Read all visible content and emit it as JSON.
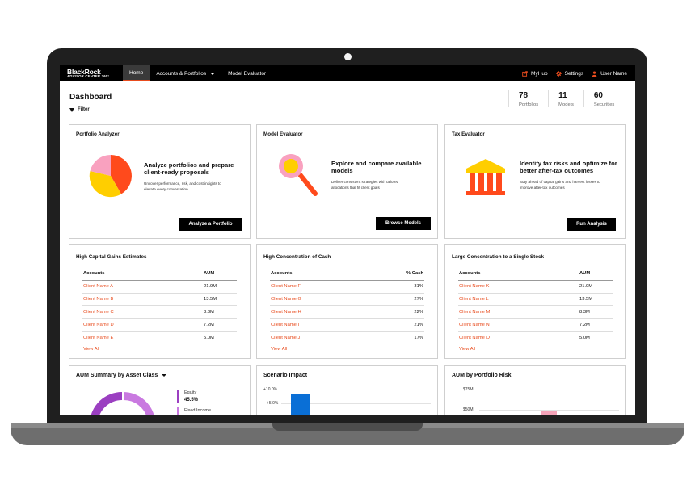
{
  "nav": {
    "logo_line1": "BlackRock",
    "logo_line2": "ADVISOR CENTER 360°",
    "items": [
      {
        "label": "Home",
        "active": true
      },
      {
        "label": "Accounts & Portfolios",
        "dropdown": true
      },
      {
        "label": "Model Evaluator"
      }
    ],
    "right": [
      {
        "label": "MyHub",
        "icon": "external-link-icon"
      },
      {
        "label": "Settings",
        "icon": "gear-icon"
      },
      {
        "label": "User Name",
        "icon": "user-icon"
      }
    ]
  },
  "page": {
    "title": "Dashboard",
    "filter_label": "Filter"
  },
  "stats": [
    {
      "value": "78",
      "label": "Portfolios"
    },
    {
      "value": "11",
      "label": "Models"
    },
    {
      "value": "60",
      "label": "Securities"
    }
  ],
  "tools": [
    {
      "title": "Portfolio Analyzer",
      "heading": "Analyze portfolios and prepare client-ready proposals",
      "desc": "Uncover performance, risk, and cost insights to elevate every conversation",
      "button": "Analyze a Portfolio",
      "icon": "pie-chart-icon"
    },
    {
      "title": "Model Evaluator",
      "heading": "Explore and compare available models",
      "desc": "Deliver consistent strategies with tailored allocations that fit client goals",
      "button": "Browse Models",
      "icon": "magnifier-icon"
    },
    {
      "title": "Tax Evaluator",
      "heading": "Identify tax risks and optimize for better after-tax outcomes",
      "desc": "Stay ahead of capital gains and harvest losses to improve after-tax outcomes",
      "button": "Run Analysis",
      "icon": "bank-building-icon"
    }
  ],
  "tables": [
    {
      "title": "High Capital Gains Estimates",
      "col1": "Accounts",
      "col2": "AUM",
      "rows": [
        [
          "Client Name A",
          "21.9M"
        ],
        [
          "Client Name B",
          "13.5M"
        ],
        [
          "Client Name C",
          "8.3M"
        ],
        [
          "Client Name D",
          "7.2M"
        ],
        [
          "Client Name E",
          "5.0M"
        ]
      ],
      "view_all": "View All"
    },
    {
      "title": "High Concentration of Cash",
      "col1": "Accounts",
      "col2": "% Cash",
      "rows": [
        [
          "Client Name F",
          "31%"
        ],
        [
          "Client Name G",
          "27%"
        ],
        [
          "Client Name H",
          "22%"
        ],
        [
          "Client Name I",
          "21%"
        ],
        [
          "Client Name J",
          "17%"
        ]
      ],
      "view_all": "View All"
    },
    {
      "title": "Large Concentration to a Single Stock",
      "col1": "Accounts",
      "col2": "AUM",
      "rows": [
        [
          "Client Name K",
          "21.9M"
        ],
        [
          "Client Name L",
          "13.5M"
        ],
        [
          "Client Name M",
          "8.3M"
        ],
        [
          "Client Name N",
          "7.2M"
        ],
        [
          "Client Name O",
          "5.0M"
        ]
      ],
      "view_all": "View All"
    }
  ],
  "bottom": {
    "aum_summary": {
      "title": "AUM Summary by Asset Class",
      "legend": [
        {
          "name": "Equity",
          "value": "45.5%",
          "color": "#9b3fc1"
        },
        {
          "name": "Fixed Income",
          "value": "",
          "color": "#c979e0"
        }
      ]
    },
    "scenario": {
      "title": "Scenario Impact",
      "ticks": [
        "+10.0%",
        "+5.0%"
      ],
      "bar_color": "#0a6fd6"
    },
    "risk": {
      "title": "AUM by Portfolio Risk",
      "ticks": [
        "$75M",
        "$50M"
      ],
      "bar_color": "#f4a3b8"
    }
  }
}
